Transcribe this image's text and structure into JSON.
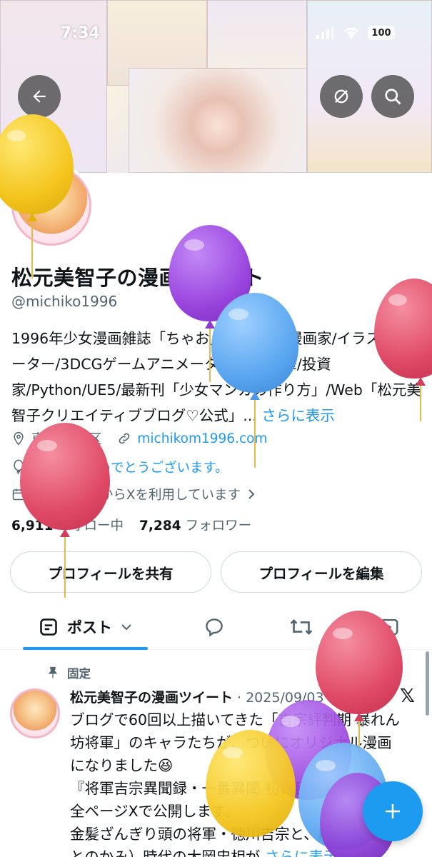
{
  "status_bar": {
    "time": "7:34",
    "battery": "100"
  },
  "profile": {
    "display_name": "松元美智子の漫画ツイート",
    "handle": "@michiko1996",
    "bio": "1996年少女漫画雑誌「ちゃお」デビュー/漫画家/イラストレーター/3DCGゲームアニメーター/書籍執筆/投資家/Python/UE5/最新刊「少女マンガの作り方」/Web「松元美智子クリエイティブブログ♡公式」...",
    "bio_more": "さらに表示",
    "location": "東京 渋谷区",
    "website": "michikom1996.com",
    "birthday_text": "お誕生日おめでとうございます。",
    "joined": "2016年3月からXを利用しています",
    "following_count": "6,911",
    "following_label": "フォロー中",
    "followers_count": "7,284",
    "followers_label": "フォロワー"
  },
  "buttons": {
    "share_profile": "プロフィールを共有",
    "edit_profile": "プロフィールを編集"
  },
  "tabs": {
    "posts": "ポスト"
  },
  "pinned_tweet": {
    "pinned_label": "固定",
    "author": "松元美智子の漫画ツイート",
    "date": "· 2025/09/03",
    "text": "ブログで60回以上描いてきた「吉宗評判期 暴れん坊将軍」のキャラたちが、ついにオリジナル漫画になりました😆\n『将軍吉宗異聞録・一番異聞 初御目見書付簿』を全ページXで公開します。\n金髪ざんぎり頭の将軍・徳川吉宗と、能登守（のとのかみ）時代の大岡忠相が",
    "more": "さらに表示"
  },
  "colors": {
    "accent": "#1d9bf0",
    "text": "#0f1419",
    "muted": "#536471"
  },
  "icons": [
    "back-arrow-icon",
    "hide-icon",
    "search-icon",
    "location-pin-icon",
    "link-icon",
    "balloon-icon",
    "calendar-icon",
    "chevron-right-icon",
    "post-icon",
    "chevron-down-icon",
    "reply-icon",
    "retweet-icon",
    "media-icon",
    "pin-icon",
    "x-logo-icon",
    "plus-icon"
  ]
}
